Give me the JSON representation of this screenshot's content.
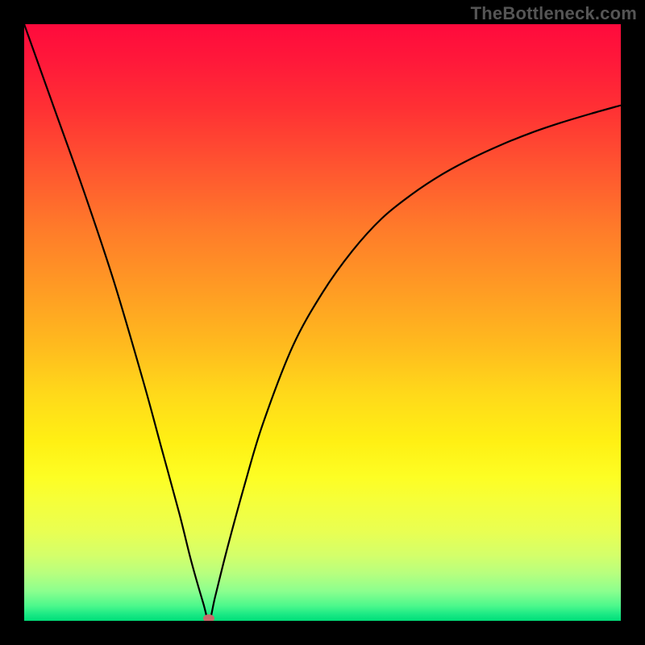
{
  "watermark": "TheBottleneck.com",
  "chart_data": {
    "type": "line",
    "title": "",
    "xlabel": "",
    "ylabel": "",
    "xlim": [
      0,
      100
    ],
    "ylim": [
      0,
      100
    ],
    "grid": false,
    "legend": false,
    "min_point": {
      "x": 31,
      "y": 0
    },
    "series": [
      {
        "name": "curve",
        "x": [
          0,
          5,
          10,
          15,
          20,
          23,
          26,
          28,
          30,
          31,
          32,
          34,
          37,
          40,
          45,
          50,
          55,
          60,
          65,
          70,
          75,
          80,
          85,
          90,
          95,
          100
        ],
        "values": [
          100,
          86,
          72,
          57,
          40,
          29,
          18,
          10,
          3,
          0,
          4,
          12,
          23,
          33,
          46,
          55,
          62,
          67.5,
          71.5,
          74.8,
          77.5,
          79.8,
          81.8,
          83.5,
          85.0,
          86.4
        ]
      }
    ],
    "background_gradient": {
      "top": "#ff0a3c",
      "mid": "#ffd91a",
      "bottom": "#00de78"
    }
  }
}
